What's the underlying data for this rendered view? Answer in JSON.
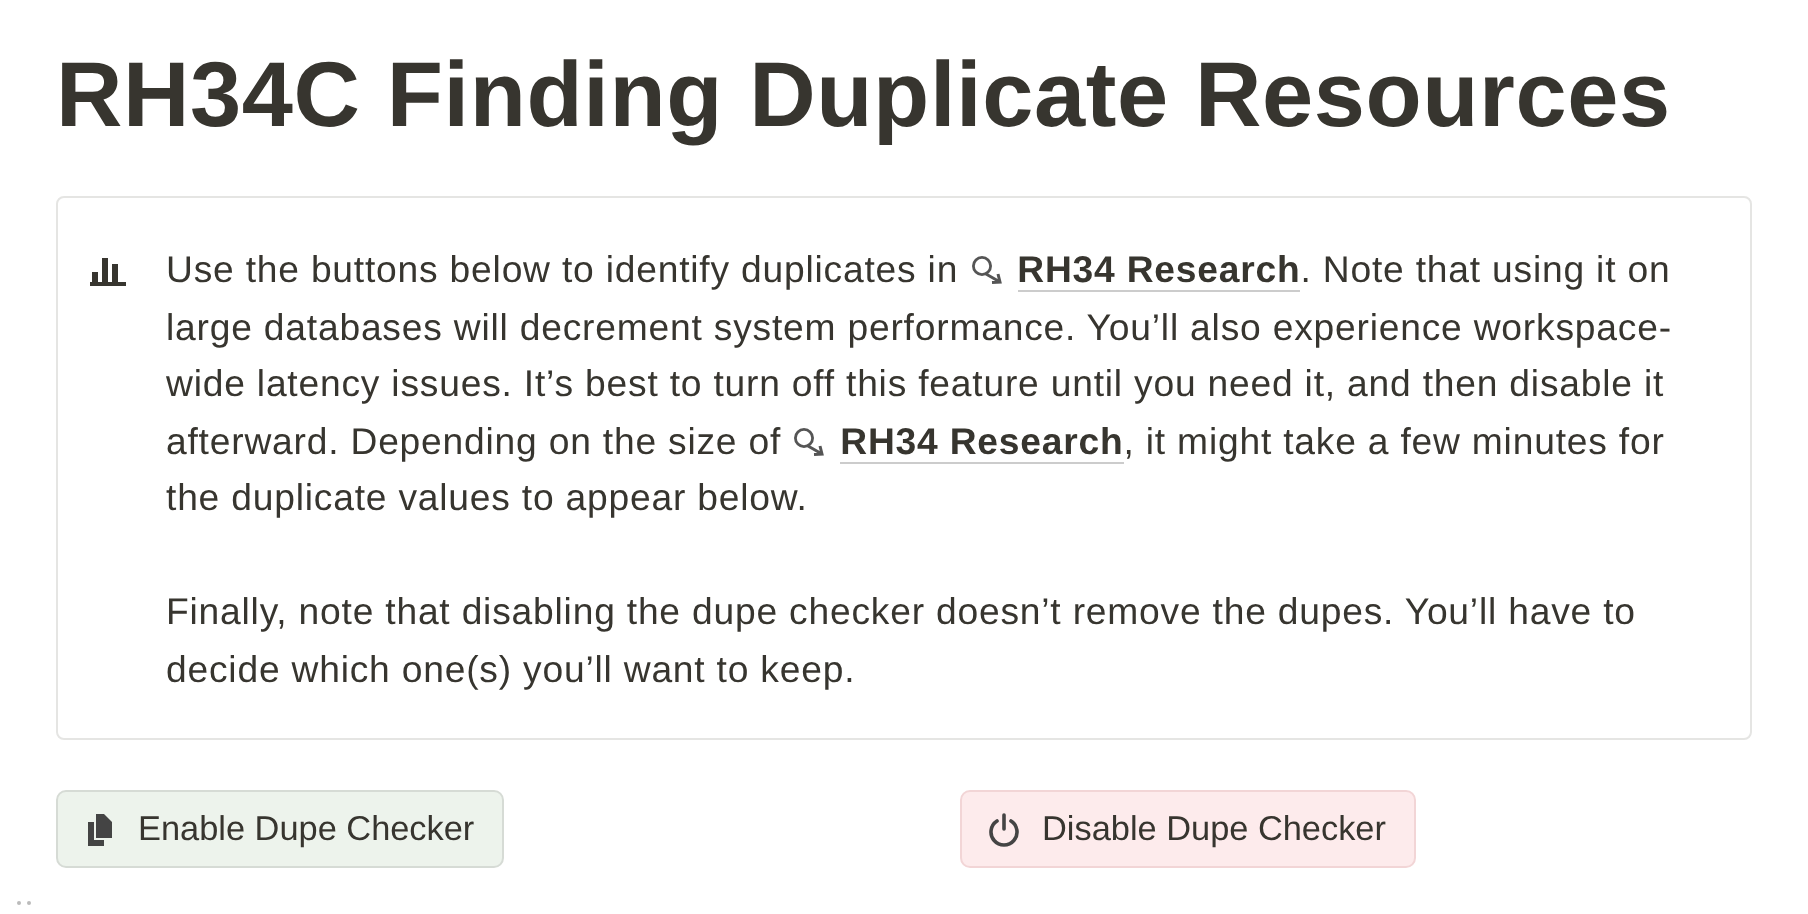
{
  "title": "RH34C Finding Duplicate Resources",
  "callout": {
    "paragraphs": [
      {
        "parts": [
          {
            "kind": "text",
            "text": "Use the buttons below to identify duplicates in "
          },
          {
            "kind": "link",
            "text": "RH34 Research"
          },
          {
            "kind": "text",
            "text": ". Note that using it on large databases will decrement system performance. You’ll also experience workspace-wide latency issues. It’s best to turn off this feature until you need it, and then disable it afterward. Depending on the size of "
          },
          {
            "kind": "link",
            "text": "RH34 Research"
          },
          {
            "kind": "text",
            "text": ", it might take a few minutes for the duplicate values to appear below."
          }
        ]
      },
      {
        "parts": [
          {
            "kind": "text",
            "text": "Finally, note that disabling the dupe checker doesn’t remove the dupes. You’ll have to decide which one(s) you’ll want to keep."
          }
        ]
      }
    ]
  },
  "buttons": [
    {
      "kind": "enable",
      "label": "Enable Dupe Checker"
    },
    {
      "kind": "disable",
      "label": "Disable Dupe Checker"
    }
  ]
}
